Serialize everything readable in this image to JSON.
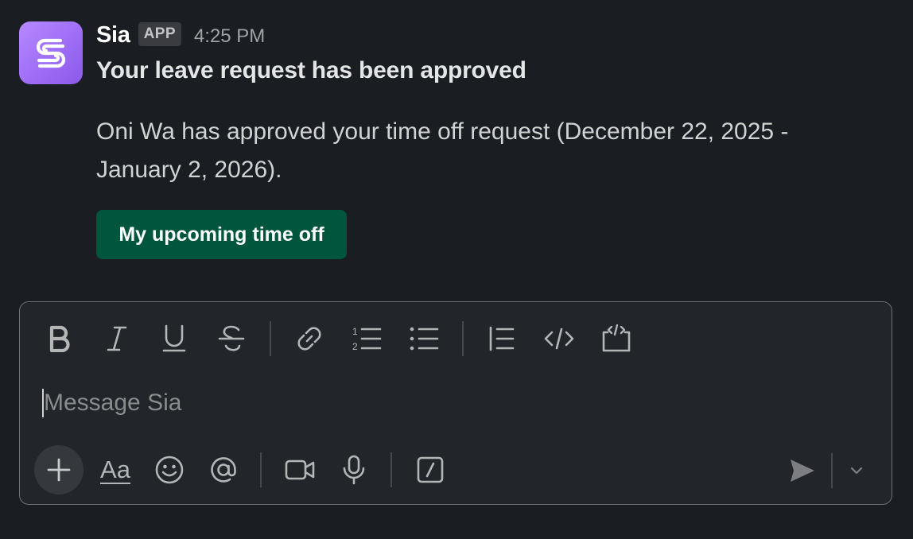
{
  "message": {
    "sender": "Sia",
    "badge": "APP",
    "time": "4:25 PM",
    "title": "Your leave request has been approved",
    "body": "Oni Wa has approved your time off request (December 22, 2025 - January 2, 2026).",
    "action_label": "My upcoming time off",
    "avatar_icon": "sia-logo-icon",
    "avatar_color": "#a97cf8",
    "button_color": "#00553d"
  },
  "composer": {
    "placeholder": "Message Sia",
    "format_tools": [
      {
        "name": "bold-icon"
      },
      {
        "name": "italic-icon"
      },
      {
        "name": "underline-icon"
      },
      {
        "name": "strikethrough-icon"
      },
      {
        "name": "link-icon"
      },
      {
        "name": "ordered-list-icon"
      },
      {
        "name": "bulleted-list-icon"
      },
      {
        "name": "blockquote-icon"
      },
      {
        "name": "code-icon"
      },
      {
        "name": "code-block-icon"
      }
    ],
    "bottom_tools": [
      {
        "name": "plus-icon"
      },
      {
        "name": "formatting-aa-icon",
        "label": "Aa"
      },
      {
        "name": "emoji-icon"
      },
      {
        "name": "mention-icon"
      },
      {
        "name": "video-icon"
      },
      {
        "name": "microphone-icon"
      },
      {
        "name": "slash-command-icon"
      },
      {
        "name": "send-icon"
      },
      {
        "name": "chevron-down-icon"
      }
    ]
  }
}
